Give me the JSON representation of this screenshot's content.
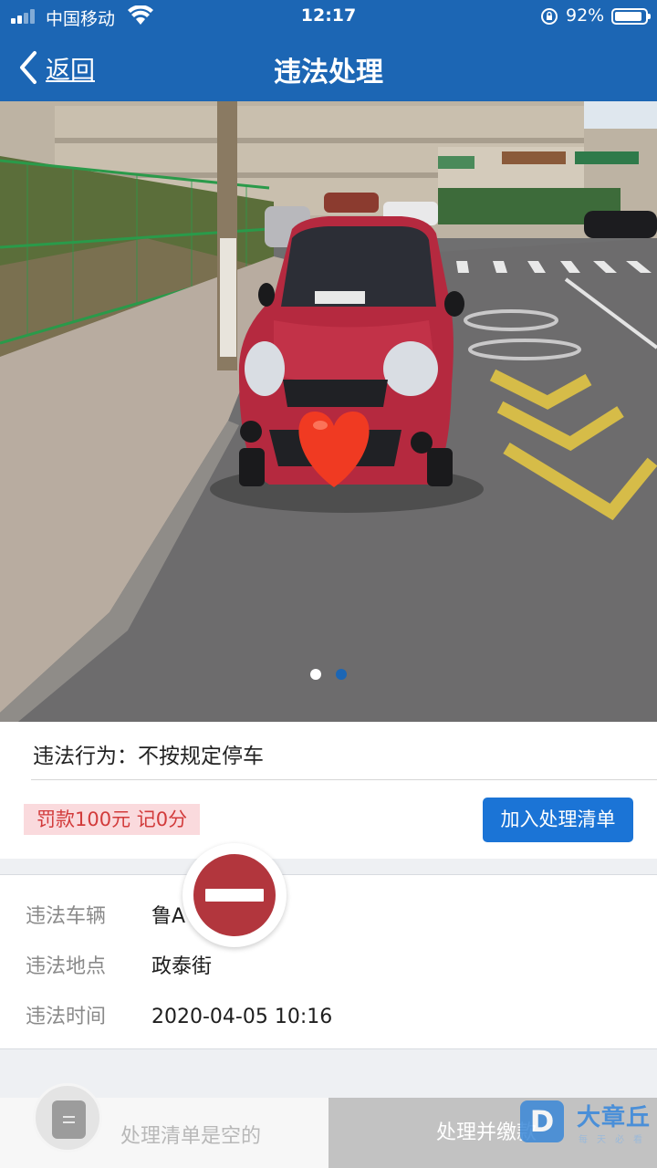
{
  "status_bar": {
    "carrier": "中国移动",
    "time": "12:17",
    "battery_text": "92%",
    "battery_level": 0.92,
    "signal_bars": 2,
    "icons": [
      "signal-icon",
      "wifi-icon",
      "orientation-lock-icon",
      "battery-icon"
    ]
  },
  "nav": {
    "back_label": "返回",
    "title": "违法处理"
  },
  "photo": {
    "page_count": 2,
    "active_page": 2
  },
  "violation": {
    "behavior": "违法行为：不按规定停车",
    "penalty": "罚款100元  记0分",
    "add_button": "加入处理清单"
  },
  "details": {
    "vehicle_label": "违法车辆",
    "vehicle_value": "鲁A",
    "location_label": "违法地点",
    "location_value": "政泰街",
    "time_label": "违法时间",
    "time_value": "2020-04-05 10:16"
  },
  "bottom_bar": {
    "empty_text": "处理清单是空的",
    "pay_button": "处理并缴款"
  },
  "watermark": {
    "logo_letter": "D",
    "name": "大章丘",
    "sub": "每天必看"
  },
  "colors": {
    "nav_blue": "#1c66b4",
    "button_blue": "#1b74d6",
    "penalty_bg": "#fadadd",
    "penalty_text": "#d23b3b",
    "remove_red": "#b2363d"
  }
}
